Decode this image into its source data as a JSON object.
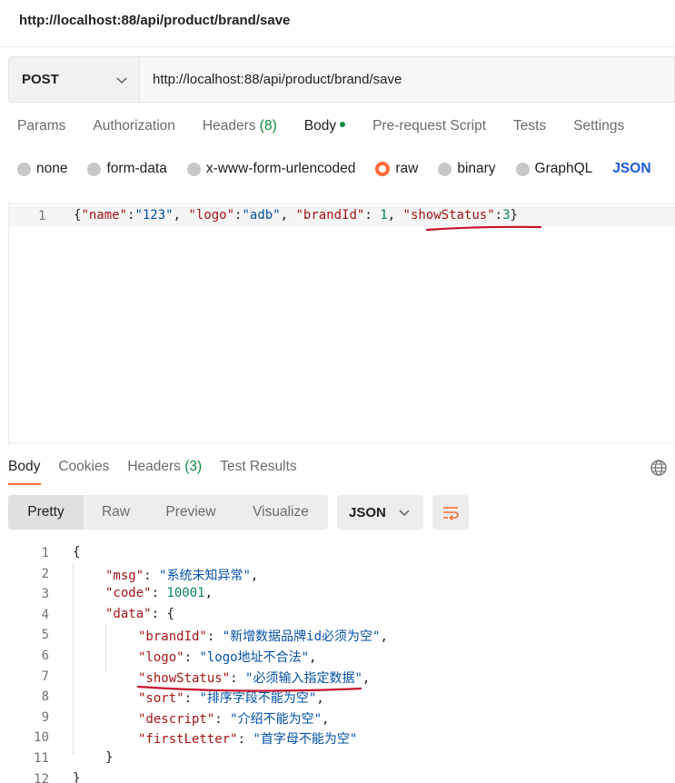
{
  "window": {
    "title": "http://localhost:88/api/product/brand/save"
  },
  "request": {
    "method": "POST",
    "url": "http://localhost:88/api/product/brand/save",
    "tabs": [
      {
        "label": "Params"
      },
      {
        "label": "Authorization"
      },
      {
        "label": "Headers",
        "count": "(8)"
      },
      {
        "label": "Body"
      },
      {
        "label": "Pre-request Script"
      },
      {
        "label": "Tests"
      },
      {
        "label": "Settings"
      }
    ],
    "body_types": [
      "none",
      "form-data",
      "x-www-form-urlencoded",
      "raw",
      "binary",
      "GraphQL"
    ],
    "selected_body_type": "raw",
    "body_format": "JSON",
    "body": {
      "line_number": "1",
      "tokens": [
        "{",
        "\"name\"",
        ":",
        "\"123\"",
        ", ",
        "\"logo\"",
        ":",
        "\"adb\"",
        ", ",
        "\"brandId\"",
        ": ",
        "1",
        ", ",
        "\"showStatus\"",
        ":",
        "3",
        "}"
      ]
    }
  },
  "response": {
    "tabs": [
      {
        "label": "Body"
      },
      {
        "label": "Cookies"
      },
      {
        "label": "Headers",
        "count": "(3)"
      },
      {
        "label": "Test Results"
      }
    ],
    "view_modes": [
      "Pretty",
      "Raw",
      "Preview",
      "Visualize"
    ],
    "format": "JSON",
    "lines": [
      {
        "n": "1",
        "open": "{"
      },
      {
        "n": "2",
        "key": "\"msg\"",
        "value": "\"系统未知异常\"",
        "end": ","
      },
      {
        "n": "3",
        "key": "\"code\"",
        "num": "10001",
        "end": ","
      },
      {
        "n": "4",
        "key": "\"data\"",
        "open": "{"
      },
      {
        "n": "5",
        "key": "\"brandId\"",
        "value": "\"新增数据品牌id必须为空\"",
        "end": ","
      },
      {
        "n": "6",
        "key": "\"logo\"",
        "value": "\"logo地址不合法\"",
        "end": ","
      },
      {
        "n": "7",
        "key": "\"showStatus\"",
        "value": "\"必须输入指定数据\"",
        "end": ","
      },
      {
        "n": "8",
        "key": "\"sort\"",
        "value": "\"排序字段不能为空\"",
        "end": ","
      },
      {
        "n": "9",
        "key": "\"descript\"",
        "value": "\"介绍不能为空\"",
        "end": ","
      },
      {
        "n": "10",
        "key": "\"firstLetter\"",
        "value": "\"首字母不能为空\""
      },
      {
        "n": "11",
        "close": "}"
      },
      {
        "n": "12",
        "close": "}"
      }
    ]
  },
  "colors": {
    "accent": "#ff6c37",
    "count_green": "#0c8a3e",
    "json_link": "#1a5ad7",
    "annotation_red": "#c8102e"
  }
}
